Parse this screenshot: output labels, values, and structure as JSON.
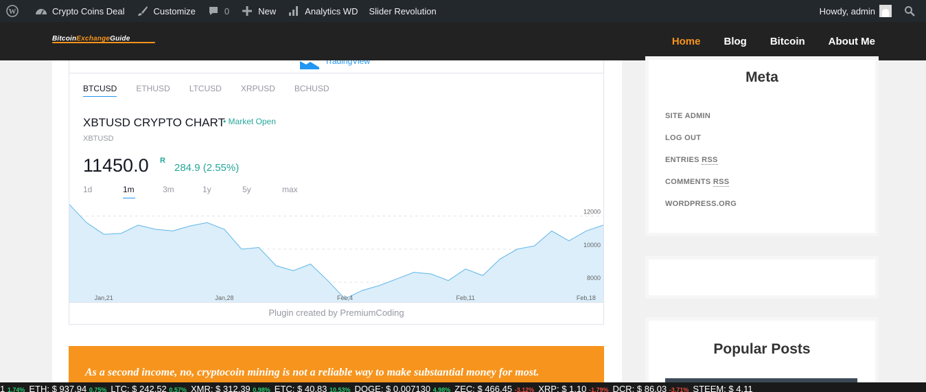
{
  "adminbar": {
    "site": "Crypto Coins Deal",
    "customize": "Customize",
    "comments_count": "0",
    "new": "New",
    "analytics": "Analytics WD",
    "slider": "Slider Revolution",
    "howdy": "Howdy, admin"
  },
  "header": {
    "logo_a": "Bitcoin",
    "logo_b": "Exchange",
    "logo_c": "Guide",
    "nav": [
      "Home",
      "Blog",
      "Bitcoin",
      "About Me"
    ]
  },
  "widget": {
    "tv_label": "TradingView",
    "tabs": [
      "BTCUSD",
      "ETHUSD",
      "LTCUSD",
      "XRPUSD",
      "BCHUSD"
    ],
    "title": "XBTUSD CRYPTO CHART",
    "market_status": "• Market Open",
    "subtitle": "XBTUSD",
    "price": "11450.0",
    "price_sup": "R",
    "change": "284.9 (2.55%)",
    "ranges": [
      "1d",
      "1m",
      "3m",
      "1y",
      "5y",
      "max"
    ],
    "credit": "Plugin created by PremiumCoding"
  },
  "chart_data": {
    "type": "area",
    "x": [
      "Jan,19",
      "Jan,20",
      "Jan,21",
      "Jan,22",
      "Jan,23",
      "Jan,24",
      "Jan,25",
      "Jan,26",
      "Jan,27",
      "Jan,28",
      "Jan,29",
      "Jan,30",
      "Jan,31",
      "Feb,1",
      "Feb,2",
      "Feb,3",
      "Feb,4",
      "Feb,5",
      "Feb,6",
      "Feb,7",
      "Feb,8",
      "Feb,9",
      "Feb,10",
      "Feb,11",
      "Feb,12",
      "Feb,13",
      "Feb,14",
      "Feb,15",
      "Feb,16",
      "Feb,17",
      "Feb,18",
      "Feb,19"
    ],
    "values": [
      12700,
      11600,
      10900,
      10950,
      11450,
      11200,
      11100,
      11400,
      11600,
      11200,
      10000,
      10100,
      9000,
      8700,
      9100,
      8100,
      7000,
      7500,
      7800,
      8200,
      8600,
      8500,
      8100,
      8800,
      8400,
      9400,
      10000,
      10200,
      11100,
      10500,
      11100,
      11450
    ],
    "xticks": [
      "Jan,21",
      "Jan,28",
      "Feb,4",
      "Feb,11",
      "Feb,18"
    ],
    "yticks": [
      "8000",
      "10000",
      "12000"
    ],
    "ylim": [
      6800,
      12900
    ],
    "grid": "horizontal dashed"
  },
  "banner": {
    "text": "As a second income, no, cryptocoin mining is not a reliable way to make substantial money for most."
  },
  "sidebar": {
    "meta_title": "Meta",
    "meta_links": [
      {
        "pre": "SITE ADMIN",
        "abbr": ""
      },
      {
        "pre": "LOG OUT",
        "abbr": ""
      },
      {
        "pre": "ENTRIES ",
        "abbr": "RSS"
      },
      {
        "pre": "COMMENTS ",
        "abbr": "RSS"
      },
      {
        "pre": "WORDPRESS.ORG",
        "abbr": ""
      }
    ],
    "popular_title": "Popular Posts"
  },
  "ticker": [
    {
      "name": "1",
      "pct": "1.74%",
      "dir": "up"
    },
    {
      "name": "ETH: $ 937.94",
      "pct": "0.75%",
      "dir": "up"
    },
    {
      "name": "LTC: $ 242.52",
      "pct": "0.57%",
      "dir": "up"
    },
    {
      "name": "XMR: $ 312.39",
      "pct": "0.98%",
      "dir": "up"
    },
    {
      "name": "ETC: $ 40.83",
      "pct": "10.53%",
      "dir": "up"
    },
    {
      "name": "DOGE: $ 0.007130",
      "pct": "4.98%",
      "dir": "up"
    },
    {
      "name": "ZEC: $ 466.45",
      "pct": "-3.12%",
      "dir": "down"
    },
    {
      "name": "XRP: $ 1.10",
      "pct": "-1.79%",
      "dir": "down"
    },
    {
      "name": "DCR: $ 86.03",
      "pct": "-3.71%",
      "dir": "down"
    },
    {
      "name": "STEEM: $ 4.11",
      "pct": "",
      "dir": "up"
    }
  ],
  "colors": {
    "accent": "#f7941d",
    "adminbar": "#23282d",
    "chart_line": "#5fb6e8",
    "chart_fill": "#dbeefa",
    "positive": "#26a69a"
  }
}
